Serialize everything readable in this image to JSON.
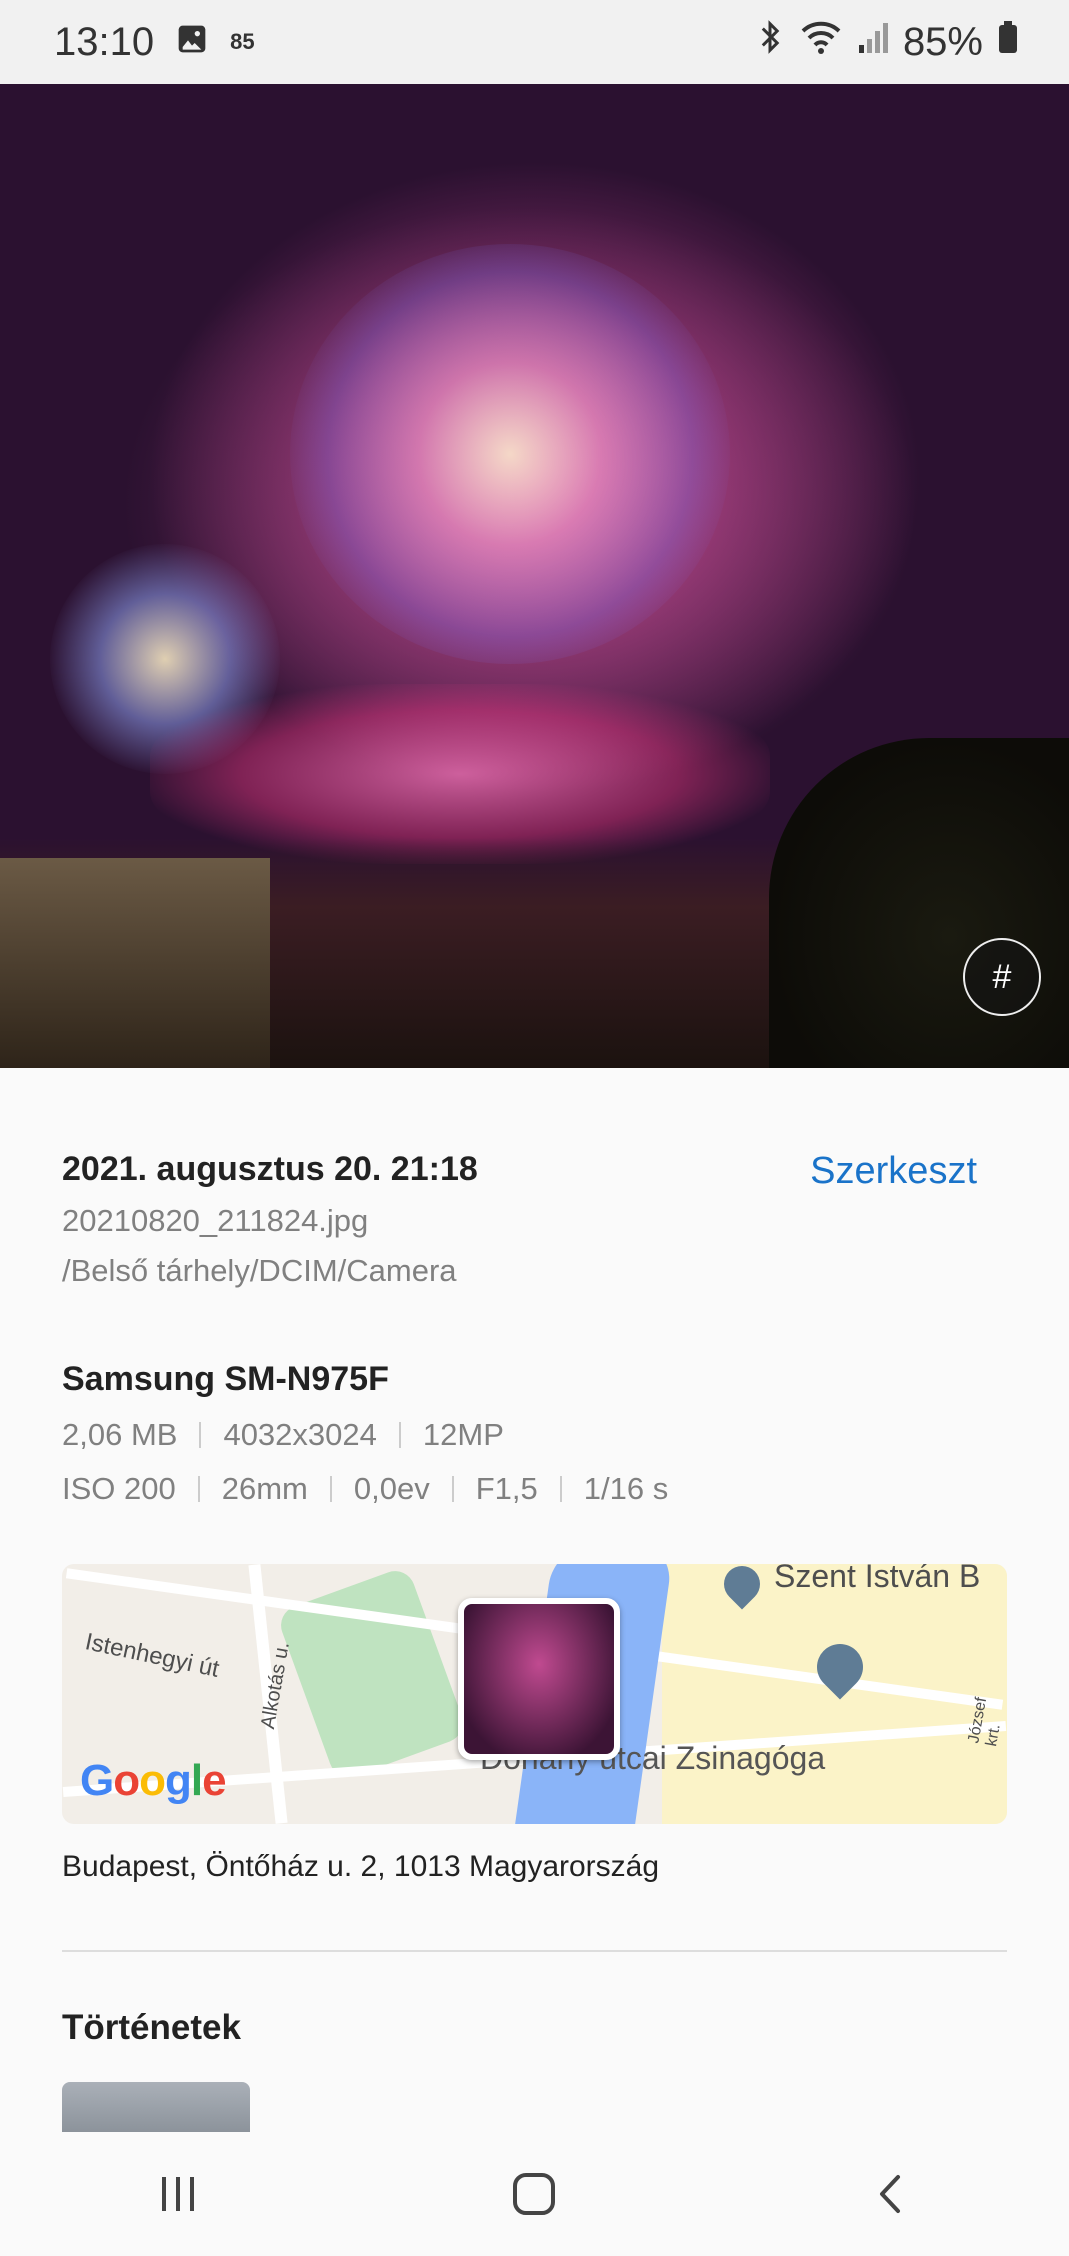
{
  "status_bar": {
    "time": "13:10",
    "image_icon": "image-icon",
    "badge": "85",
    "bluetooth_icon": "bluetooth-icon",
    "wifi_icon": "wifi-icon",
    "signal_icon": "signal-icon",
    "battery": "85%",
    "battery_icon": "battery-icon"
  },
  "photo": {
    "hashtag_label": "#"
  },
  "details": {
    "date": "2021. augusztus 20. 21:18",
    "edit_label": "Szerkeszt",
    "filename": "20210820_211824.jpg",
    "path": "/Belső tárhely/DCIM/Camera"
  },
  "device": {
    "name": "Samsung SM-N975F",
    "size": "2,06 MB",
    "resolution": "4032x3024",
    "megapixels": "12MP",
    "iso": "ISO 200",
    "focal": "26mm",
    "ev": "0,0ev",
    "aperture": "F1,5",
    "shutter": "1/16 s"
  },
  "map": {
    "label_street": "Istenhegyi út",
    "label_alkotas": "Alkotás u.",
    "label_szent": "Szent István B",
    "label_synagogue": "Dohány utcai Zsinagóga",
    "label_jozsef": "József krt.",
    "google_parts": [
      "G",
      "o",
      "o",
      "g",
      "l",
      "e"
    ]
  },
  "address": "Budapest, Öntőház u. 2, 1013 Magyarország",
  "stories": {
    "title": "Történetek"
  },
  "nav": {
    "recent_icon": "recent-apps-icon",
    "home_icon": "home-icon",
    "back_icon": "back-icon"
  }
}
